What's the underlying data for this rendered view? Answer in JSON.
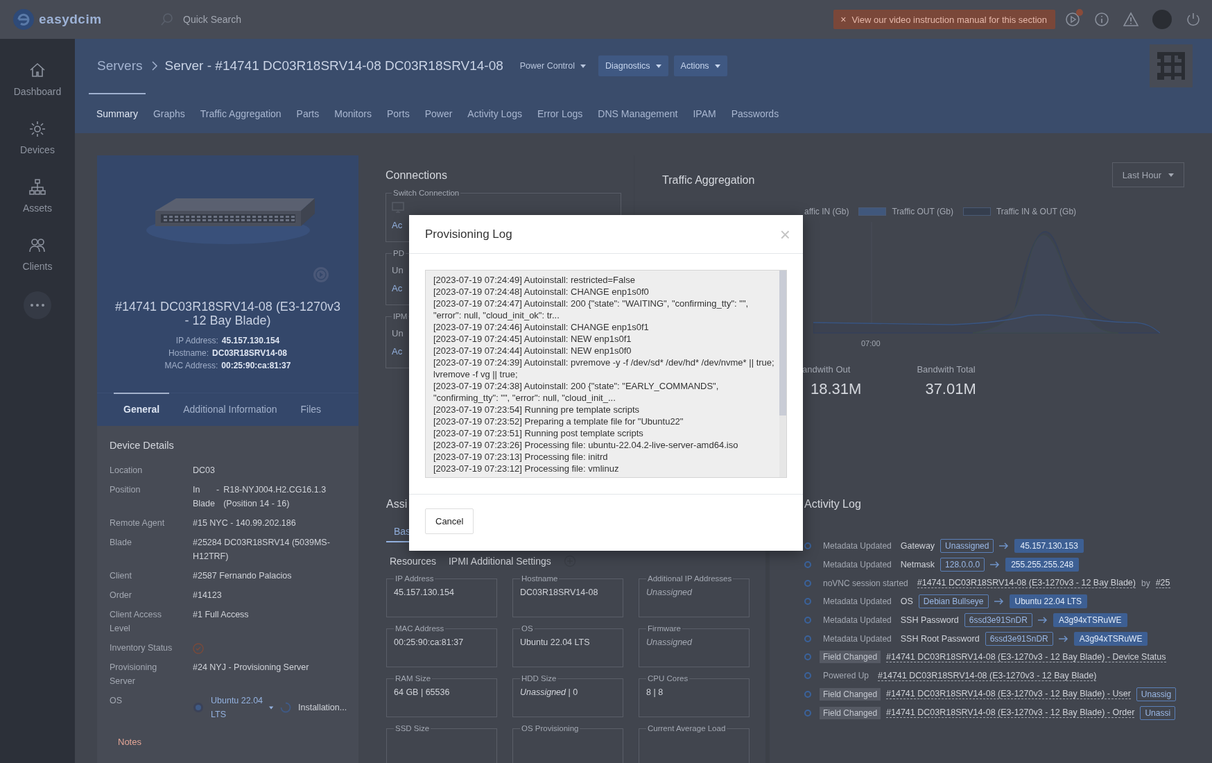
{
  "topbar": {
    "logo": "easydcim",
    "search": {
      "placeholder": "Quick Search"
    },
    "banner": {
      "close": "×",
      "text": "View our video instruction manual for this section"
    }
  },
  "sidebar": {
    "items": [
      {
        "label": "Dashboard"
      },
      {
        "label": "Devices"
      },
      {
        "label": "Assets"
      },
      {
        "label": "Clients"
      }
    ]
  },
  "header": {
    "breadcrumb": [
      "Servers",
      "Server - #14741 DC03R18SRV14-08 DC03R18SRV14-08"
    ],
    "buttons": [
      {
        "label": "Power Control",
        "kind": "plain"
      },
      {
        "label": "Diagnostics",
        "kind": "filled"
      },
      {
        "label": "Actions",
        "kind": "filled"
      }
    ],
    "tabs": [
      {
        "label": "Summary",
        "selected": true
      },
      {
        "label": "Graphs",
        "selected": false
      },
      {
        "label": "Traffic Aggregation",
        "selected": false
      },
      {
        "label": "Parts",
        "selected": false
      },
      {
        "label": "Monitors",
        "selected": false
      },
      {
        "label": "Ports",
        "selected": false
      },
      {
        "label": "Power",
        "selected": false
      },
      {
        "label": "Activity Logs",
        "selected": false
      },
      {
        "label": "Error Logs",
        "selected": false
      },
      {
        "label": "DNS Management",
        "selected": false
      },
      {
        "label": "IPAM",
        "selected": false
      },
      {
        "label": "Passwords",
        "selected": false
      }
    ]
  },
  "device_card": {
    "title": "#14741 DC03R18SRV14-08 (E3-1270v3 - 12 Bay Blade)",
    "info": [
      {
        "label": "IP Address:",
        "value": "45.157.130.154"
      },
      {
        "label": "Hostname:",
        "value": "DC03R18SRV14-08"
      },
      {
        "label": "MAC Address:",
        "value": "00:25:90:ca:81:37"
      }
    ],
    "tabs": [
      {
        "label": "General",
        "selected": true
      },
      {
        "label": "Additional Information",
        "selected": false
      },
      {
        "label": "Files",
        "selected": false
      }
    ]
  },
  "device_details": {
    "title": "Device Details",
    "rows": [
      {
        "kind": "text",
        "label": "Location",
        "value": "DC03"
      },
      {
        "kind": "position",
        "label": "Position",
        "value": "In Blade",
        "separator": "-",
        "location": "R18-NYJ004.H2.CG16.1.3 (Position 14 - 16)"
      },
      {
        "kind": "text",
        "label": "Remote Agent",
        "value": "#15 NYC - 140.99.202.186"
      },
      {
        "kind": "text",
        "label": "Blade",
        "value": "#25284 DC03R18SRV14 (5039MS-H12TRF)"
      },
      {
        "kind": "text",
        "label": "Client",
        "value": "#2587 Fernando Palacios"
      },
      {
        "kind": "text",
        "label": "Order",
        "value": "#14123"
      },
      {
        "kind": "text",
        "label": "Client Access Level",
        "value": "#1 Full Access"
      },
      {
        "kind": "status",
        "label": "Inventory Status",
        "verified": true
      },
      {
        "kind": "text",
        "label": "Provisioning Server",
        "value": "#24 NYJ - Provisioning Server"
      },
      {
        "kind": "os",
        "label": "OS",
        "value": "Ubuntu 22.04 LTS",
        "status": "Installation..."
      }
    ],
    "notes": "Notes"
  },
  "connections": {
    "title": "Connections",
    "groups": [
      {
        "legend": "Switch Connection",
        "lines": [
          "Ac"
        ]
      },
      {
        "legend": "PD",
        "lines": [
          "Un",
          "Ac"
        ]
      },
      {
        "legend": "IPM",
        "lines": [
          "Un",
          "Ac"
        ]
      }
    ]
  },
  "traffic": {
    "title": "Traffic Aggregation",
    "range": "Last Hour",
    "legend": [
      {
        "label": "affic IN (Gb)"
      },
      {
        "label": "Traffic OUT (Gb)",
        "color": "#40577c"
      },
      {
        "label": "Traffic IN & OUT (Gb)",
        "color": "#353e4e"
      }
    ],
    "x_label": "07:00",
    "stats": [
      {
        "label": "andwith Out",
        "value": "18.31M"
      },
      {
        "label": "Bandwith Total",
        "value": "37.01M"
      }
    ]
  },
  "assigned": {
    "title": "Assi",
    "tabs": [
      {
        "label": "Bas",
        "selected": true
      }
    ],
    "subtabs": [
      "Resources",
      "IPMI Additional Settings"
    ],
    "fields": [
      {
        "legend": "IP Address",
        "value": "45.157.130.154",
        "kind": "value"
      },
      {
        "legend": "Hostname",
        "value": "DC03R18SRV14-08",
        "kind": "value"
      },
      {
        "legend": "Additional IP Addresses",
        "value": "Unassigned",
        "kind": "empty"
      },
      {
        "legend": "MAC Address",
        "value": "00:25:90:ca:81:37",
        "kind": "value"
      },
      {
        "legend": "OS",
        "value": "Ubuntu 22.04 LTS",
        "kind": "value"
      },
      {
        "legend": "Firmware",
        "value": "Unassigned",
        "kind": "empty"
      },
      {
        "legend": "RAM Size",
        "value": "64 GB | 65536",
        "kind": "value"
      },
      {
        "legend": "HDD Size",
        "value": "*Unassigned* | 0",
        "kind": "value"
      },
      {
        "legend": "CPU Cores",
        "value": "8 | 8",
        "kind": "value"
      },
      {
        "legend": "SSD Size"
      },
      {
        "legend": "OS Provisioning"
      },
      {
        "legend": "Current Average Load"
      }
    ]
  },
  "activity_log": {
    "title": "Activity Log",
    "entries": [
      {
        "event": "Metadata Updated",
        "highlighted": false,
        "subject": "Gateway",
        "linked": false,
        "from": "Unassigned",
        "to": "45.157.130.153"
      },
      {
        "event": "Metadata Updated",
        "highlighted": false,
        "subject": "Netmask",
        "linked": false,
        "from": "128.0.0.0",
        "to": "255.255.255.248"
      },
      {
        "event": "noVNC session started",
        "highlighted": false,
        "subject": "#14741 DC03R18SRV14-08 (E3-1270v3 - 12 Bay Blade)",
        "linked": true,
        "by": "by",
        "actor": "#25"
      },
      {
        "event": "Metadata Updated",
        "highlighted": false,
        "subject": "OS",
        "linked": false,
        "from": "Debian Bullseye",
        "to": "Ubuntu 22.04 LTS"
      },
      {
        "event": "Metadata Updated",
        "highlighted": false,
        "subject": "SSH Password",
        "linked": false,
        "from": "6ssd3e91SnDR",
        "to": "A3g94xTSRuWE"
      },
      {
        "event": "Metadata Updated",
        "highlighted": false,
        "subject": "SSH Root Password",
        "linked": false,
        "from": "6ssd3e91SnDR",
        "to": "A3g94xTSRuWE"
      },
      {
        "event": "Field Changed",
        "highlighted": true,
        "subject": "#14741 DC03R18SRV14-08 (E3-1270v3 - 12 Bay Blade) - Device Status",
        "linked": true
      },
      {
        "event": "Powered Up",
        "highlighted": false,
        "subject": "#14741 DC03R18SRV14-08 (E3-1270v3 - 12 Bay Blade)",
        "linked": true
      },
      {
        "event": "Field Changed",
        "highlighted": true,
        "subject": "#14741 DC03R18SRV14-08 (E3-1270v3 - 12 Bay Blade) - User",
        "linked": true,
        "from": "Unassig"
      },
      {
        "event": "Field Changed",
        "highlighted": true,
        "subject": "#14741 DC03R18SRV14-08 (E3-1270v3 - 12 Bay Blade) - Order",
        "linked": true,
        "from": "Unassi"
      }
    ]
  },
  "modal": {
    "title": "Provisioning Log",
    "close": "×",
    "log": [
      "[2023-07-19 07:24:49] Autoinstall: restricted=False",
      "[2023-07-19 07:24:48] Autoinstall: CHANGE enp1s0f0",
      "[2023-07-19 07:24:47] Autoinstall: 200 {\"state\": \"WAITING\", \"confirming_tty\": \"\", \"error\": null, \"cloud_init_ok\": tr...",
      "[2023-07-19 07:24:46] Autoinstall: CHANGE enp1s0f1",
      "[2023-07-19 07:24:45] Autoinstall: NEW enp1s0f1",
      "[2023-07-19 07:24:44] Autoinstall: NEW enp1s0f0",
      "[2023-07-19 07:24:39] Autoinstall: pvremove -y -f /dev/sd* /dev/hd* /dev/nvme* || true; lvremove -f vg || true;",
      "[2023-07-19 07:24:38] Autoinstall: 200 {\"state\": \"EARLY_COMMANDS\", \"confirming_tty\": \"\", \"error\": null, \"cloud_init_...",
      "[2023-07-19 07:23:54] Running pre template scripts",
      "[2023-07-19 07:23:52] Preparing a template file for \"Ubuntu22\"",
      "[2023-07-19 07:23:51] Running post template scripts",
      "[2023-07-19 07:23:26] Processing file: ubuntu-22.04.2-live-server-amd64.iso",
      "[2023-07-19 07:23:13] Processing file: initrd",
      "[2023-07-19 07:23:12] Processing file: vmlinuz"
    ],
    "buttons": [
      "Cancel"
    ]
  }
}
